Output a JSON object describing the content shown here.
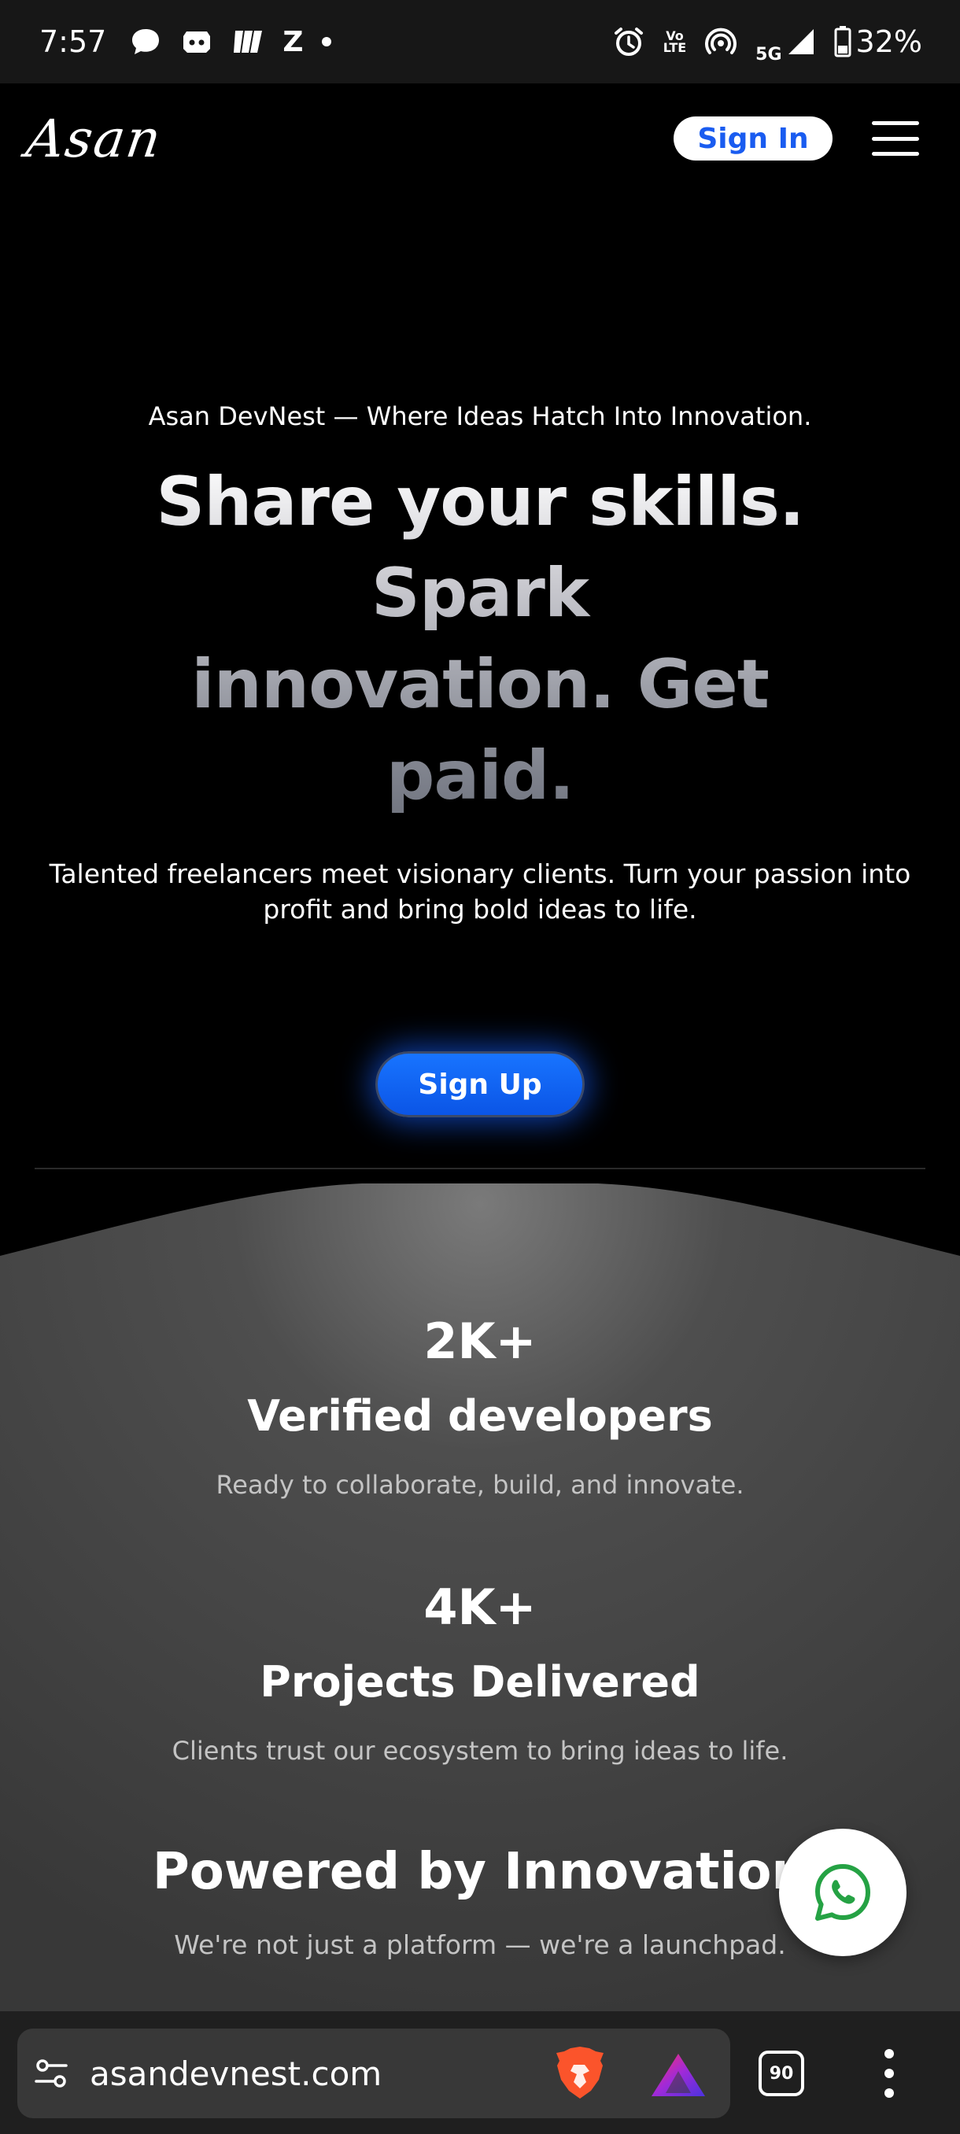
{
  "status_bar": {
    "time": "7:57",
    "notification_icons": [
      "chat-bubble-icon",
      "discord-icon",
      "app-icon",
      "z-icon",
      "dot-icon"
    ],
    "right_icons": [
      "alarm-icon",
      "volte-icon",
      "hotspot-icon",
      "signal-icon",
      "battery-icon"
    ],
    "volte_label_top": "Vo",
    "volte_label_bottom": "LTE",
    "network": "5G",
    "battery": "32%"
  },
  "header": {
    "logo": "Asan",
    "sign_in_label": "Sign In",
    "colors": {
      "accent": "#1a5cf0"
    }
  },
  "hero": {
    "tagline": "Asan DevNest — Where Ideas Hatch Into Innovation.",
    "heading_line1": "Share your skills.",
    "heading_line2": "Spark",
    "heading_line3": "innovation. Get",
    "heading_line4": "paid.",
    "subtitle": "Talented freelancers meet visionary clients. Turn your passion into profit and bring bold ideas to life.",
    "signup_label": "Sign Up"
  },
  "stats": [
    {
      "number": "2K+",
      "title": "Verified developers",
      "description": "Ready to collaborate, build, and innovate."
    },
    {
      "number": "4K+",
      "title": "Projects Delivered",
      "description": "Clients trust our ecosystem to bring ideas to life."
    }
  ],
  "powered": {
    "title": "Powered by Innovation",
    "subtitle": "We're not just a platform — we're a launchpad."
  },
  "whatsapp": {
    "icon": "whatsapp-icon",
    "color": "#25a244"
  },
  "browser": {
    "url": "asandevnest.com",
    "tab_count": "90",
    "icons": [
      "site-settings-icon",
      "brave-shields-icon",
      "brave-rewards-icon",
      "tabs-icon",
      "more-icon"
    ]
  }
}
